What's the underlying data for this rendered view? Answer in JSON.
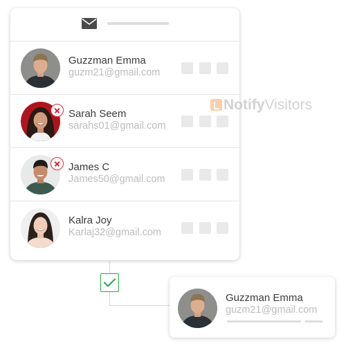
{
  "contacts": [
    {
      "name": "Guzzman Emma",
      "email": "guzm21@gmail.com",
      "rejected": false
    },
    {
      "name": "Sarah Seem",
      "email": "sarahs01@gmail.com",
      "rejected": true
    },
    {
      "name": "James C",
      "email": "James50@gmail.com",
      "rejected": true
    },
    {
      "name": "Kalra Joy",
      "email": "Karlaj32@gmail.com",
      "rejected": false
    }
  ],
  "result": {
    "name": "Guzzman Emma",
    "email": "guzm21@gmail.com"
  },
  "watermark": {
    "brand_bold": "Notify",
    "brand_light": "Visitors"
  },
  "colors": {
    "reject": "#e1253a",
    "approve": "#27a844",
    "muted_text": "#bcbcbc",
    "name_text": "#3a3a3a"
  },
  "icons": {
    "header": "mail-icon",
    "status_rejected": "reject-icon",
    "connector": "checkbox-icon"
  }
}
